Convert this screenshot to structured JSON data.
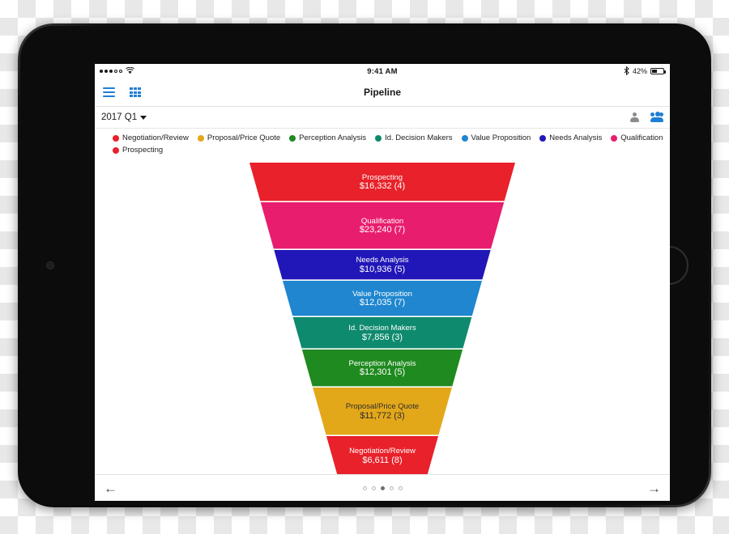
{
  "status_bar": {
    "signal_icon": "signal-dots-icon",
    "signal_filled": 3,
    "signal_total": 5,
    "wifi_icon": "wifi-icon",
    "time": "9:41 AM",
    "bluetooth_icon": "bluetooth-icon",
    "battery_percent": "42%",
    "battery_icon": "battery-icon",
    "battery_level": 42
  },
  "navbar": {
    "menu_icon": "hamburger-menu-icon",
    "grid_icon": "grid-view-icon",
    "title": "Pipeline"
  },
  "filterbar": {
    "period": "2017 Q1",
    "caret_icon": "chevron-down-icon",
    "person_icon": "person-icon",
    "group_icon": "people-group-icon"
  },
  "legend": {
    "items": [
      {
        "label": "Negotiation/Review",
        "color": "#e8212a"
      },
      {
        "label": "Proposal/Price Quote",
        "color": "#e3a81a"
      },
      {
        "label": "Perception Analysis",
        "color": "#1f8a1f"
      },
      {
        "label": "Id. Decision Makers",
        "color": "#0e8a6e"
      },
      {
        "label": "Value Proposition",
        "color": "#1f86cf"
      },
      {
        "label": "Needs Analysis",
        "color": "#2117b8"
      },
      {
        "label": "Qualification",
        "color": "#e81d6e"
      },
      {
        "label": "Prospecting",
        "color": "#e8212a"
      }
    ]
  },
  "bottombar": {
    "prev_icon": "arrow-left-icon",
    "prev_label": "←",
    "next_icon": "arrow-right-icon",
    "next_label": "→",
    "pages": 5,
    "active_page": 3
  },
  "chart_data": {
    "type": "funnel",
    "title": "Pipeline",
    "period": "2017 Q1",
    "currency": "$",
    "stages": [
      {
        "label": "Prospecting",
        "amount": 16332,
        "amount_text": "$16,332",
        "count": 4,
        "value_text": "$16,332 (4)",
        "color": "#e8212a",
        "text_color": "#ffffff"
      },
      {
        "label": "Qualification",
        "amount": 23240,
        "amount_text": "$23,240",
        "count": 7,
        "value_text": "$23,240 (7)",
        "color": "#e81d6e",
        "text_color": "#ffffff"
      },
      {
        "label": "Needs Analysis",
        "amount": 10936,
        "amount_text": "$10,936",
        "count": 5,
        "value_text": "$10,936 (5)",
        "color": "#2117b8",
        "text_color": "#ffffff"
      },
      {
        "label": "Value Proposition",
        "amount": 12035,
        "amount_text": "$12,035",
        "count": 7,
        "value_text": "$12,035 (7)",
        "color": "#1f86cf",
        "text_color": "#ffffff"
      },
      {
        "label": "Id. Decision Makers",
        "amount": 7856,
        "amount_text": "$7,856",
        "count": 3,
        "value_text": "$7,856 (3)",
        "color": "#0e8a6e",
        "text_color": "#ffffff"
      },
      {
        "label": "Perception Analysis",
        "amount": 12301,
        "amount_text": "$12,301",
        "count": 5,
        "value_text": "$12,301 (5)",
        "color": "#1f8a1f",
        "text_color": "#ffffff"
      },
      {
        "label": "Proposal/Price Quote",
        "amount": 11772,
        "amount_text": "$11,772",
        "count": 3,
        "value_text": "$11,772 (3)",
        "color": "#e3a81a",
        "text_color": "#2d2d2d"
      },
      {
        "label": "Negotiation/Review",
        "amount": 6611,
        "amount_text": "$6,611",
        "count": 8,
        "value_text": "$6,611 (8)",
        "color": "#e8212a",
        "text_color": "#ffffff"
      }
    ]
  }
}
